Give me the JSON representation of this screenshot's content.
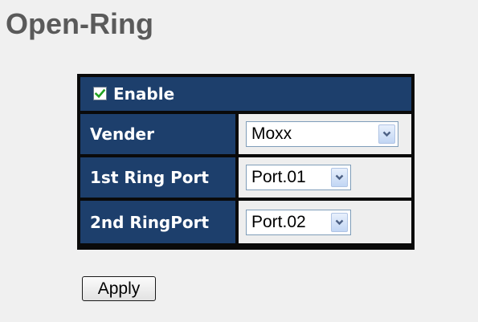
{
  "page": {
    "title": "Open-Ring"
  },
  "form": {
    "enable": {
      "label": "Enable",
      "checked": true
    },
    "rows": [
      {
        "label": "Vender",
        "selected": "Moxx"
      },
      {
        "label": "1st Ring Port",
        "selected": "Port.01"
      },
      {
        "label": "2nd RingPort",
        "selected": "Port.02"
      }
    ],
    "apply_label": "Apply"
  },
  "icons": {
    "checkbox": "checkmark-icon",
    "dropdown": "chevron-down-icon"
  },
  "colors": {
    "header_bg": "#1d3f6c",
    "table_border": "#0a0a0a",
    "value_bg": "#eeeeee",
    "checkmark": "#21a121",
    "chevron": "#4d6185",
    "title": "#5a5a5a"
  }
}
